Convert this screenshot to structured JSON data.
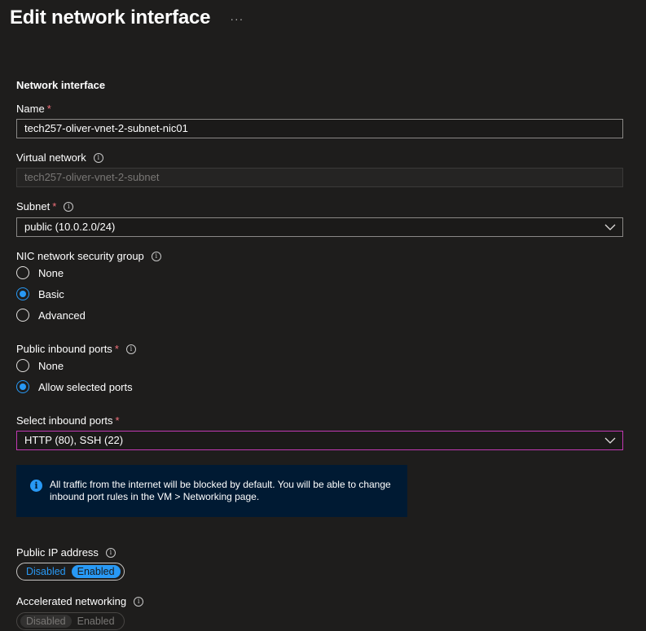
{
  "header": {
    "title": "Edit network interface",
    "more_label": "···"
  },
  "section": {
    "title": "Network interface"
  },
  "name_field": {
    "label": "Name",
    "required_mark": "*",
    "value": "tech257-oliver-vnet-2-subnet-nic01"
  },
  "virtual_network": {
    "label": "Virtual network",
    "value": "tech257-oliver-vnet-2-subnet"
  },
  "subnet": {
    "label": "Subnet",
    "required_mark": "*",
    "value": "public (10.0.2.0/24)"
  },
  "nsg": {
    "label": "NIC network security group",
    "options": [
      "None",
      "Basic",
      "Advanced"
    ],
    "selected": "Basic"
  },
  "inbound_ports": {
    "label": "Public inbound ports",
    "required_mark": "*",
    "options": [
      "None",
      "Allow selected ports"
    ],
    "selected": "Allow selected ports"
  },
  "select_ports": {
    "label": "Select inbound ports",
    "required_mark": "*",
    "value": "HTTP (80), SSH (22)"
  },
  "info_message": {
    "text": "All traffic from the internet will be blocked by default. You will be able to change inbound port rules in the VM > Networking page."
  },
  "public_ip": {
    "label": "Public IP address",
    "options": [
      "Disabled",
      "Enabled"
    ],
    "selected": "Enabled"
  },
  "accelerated_networking": {
    "label": "Accelerated networking",
    "options": [
      "Disabled",
      "Enabled"
    ],
    "selected": "Disabled",
    "disabled": true
  },
  "colors": {
    "background": "#1e1d1c",
    "accent": "#2899f5",
    "required": "#f1707b",
    "focus_border": "#c239b3",
    "info_bg": "#001a33"
  }
}
